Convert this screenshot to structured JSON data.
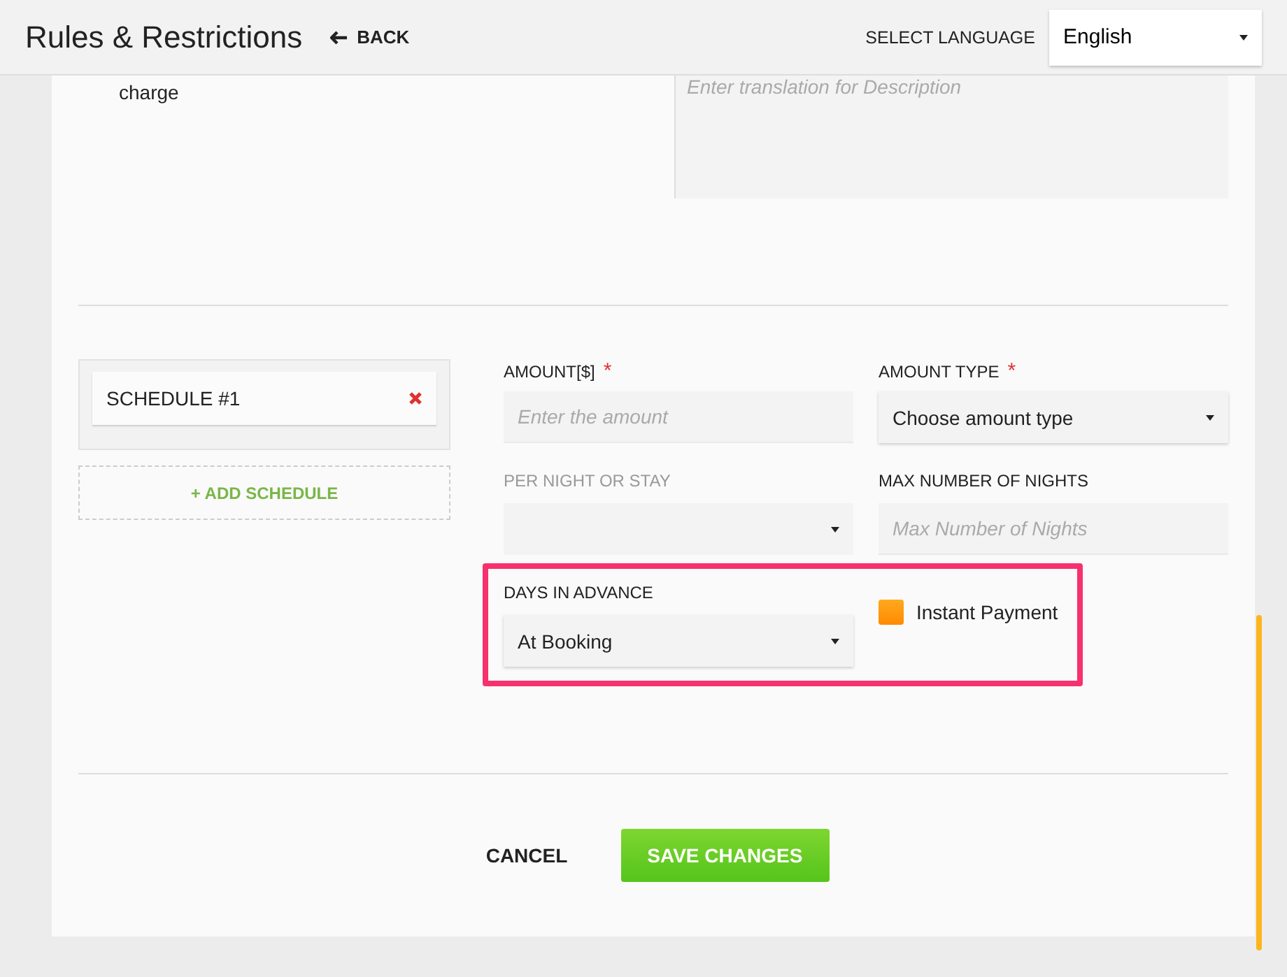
{
  "header": {
    "title": "Rules & Restrictions",
    "back": "BACK",
    "language_label": "SELECT LANGUAGE",
    "language": "English"
  },
  "description": {
    "text": "charge",
    "placeholder": "Enter translation for Description"
  },
  "schedules": [
    {
      "label": "SCHEDULE #1"
    }
  ],
  "add_schedule": "+ ADD SCHEDULE",
  "fields": [
    {
      "label": "AMOUNT[$]",
      "required_mark": "*",
      "kind": "input",
      "placeholder": "Enter the amount",
      "disabled": false
    },
    {
      "label": "AMOUNT TYPE",
      "required_mark": "*",
      "kind": "select",
      "value": "Choose amount type",
      "disabled": false
    },
    {
      "label": "PER NIGHT OR STAY",
      "kind": "select",
      "disabled": true
    },
    {
      "label": "MAX NUMBER OF NIGHTS",
      "kind": "input",
      "placeholder": "Max Number of Nights",
      "disabled": false
    }
  ],
  "days_in_advance": {
    "label": "DAYS IN ADVANCE",
    "value": "At Booking"
  },
  "instant_payment": {
    "label": "Instant Payment",
    "checked": true
  },
  "buttons": {
    "cancel": "CANCEL",
    "save": "SAVE CHANGES"
  }
}
